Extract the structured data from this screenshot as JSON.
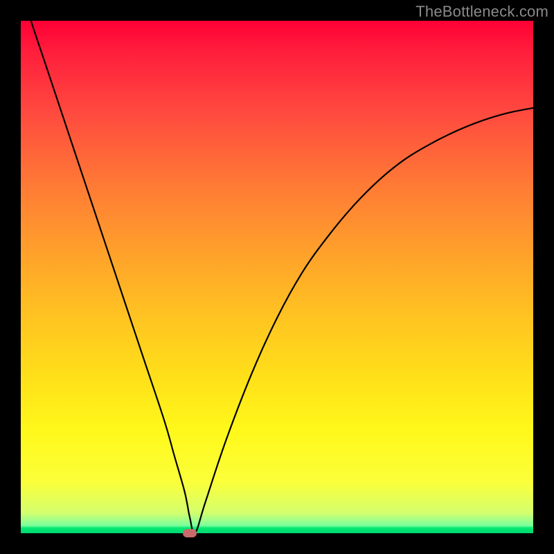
{
  "watermark": "TheBottleneck.com",
  "colors": {
    "frame": "#000000",
    "gradient_top": "#ff0035",
    "gradient_bottom": "#00d873",
    "curve": "#000000",
    "marker": "#c96b6b"
  },
  "chart_data": {
    "type": "line",
    "title": "",
    "xlabel": "",
    "ylabel": "",
    "xlim": [
      0,
      100
    ],
    "ylim": [
      0,
      100
    ],
    "grid": false,
    "legend": false,
    "series": [
      {
        "name": "bottleneck-curve",
        "x": [
          0,
          2,
          5,
          8,
          12,
          16,
          20,
          24,
          28,
          30,
          32,
          33,
          34,
          36,
          40,
          45,
          50,
          55,
          60,
          65,
          70,
          75,
          80,
          85,
          90,
          95,
          100
        ],
        "values": [
          107,
          100,
          91,
          82,
          70,
          58,
          46,
          34,
          22,
          15,
          8,
          3,
          0,
          6,
          18,
          31,
          42,
          51,
          58,
          64,
          69,
          73,
          76,
          78.5,
          80.5,
          82,
          83
        ]
      }
    ],
    "marker": {
      "x": 33,
      "y": 0
    },
    "note": "Values are read off the plot in percent of axis span; left branch is a steep near-linear descent from above the top-left to the minimum at x≈33, right branch rises with decreasing slope toward ~83% at right edge."
  }
}
